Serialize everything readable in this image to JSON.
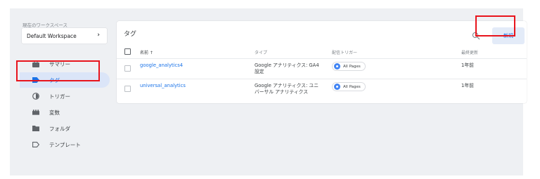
{
  "workspace": {
    "label": "現在のワークスペース",
    "name": "Default Workspace",
    "chevron": "›"
  },
  "sidebar": {
    "items": [
      {
        "label": "サマリー",
        "icon": "briefcase-icon"
      },
      {
        "label": "タグ",
        "icon": "tag-icon",
        "active": true
      },
      {
        "label": "トリガー",
        "icon": "trigger-icon"
      },
      {
        "label": "変数",
        "icon": "variables-icon"
      },
      {
        "label": "フォルダ",
        "icon": "folder-icon"
      },
      {
        "label": "テンプレート",
        "icon": "template-icon"
      }
    ]
  },
  "main": {
    "title": "タグ",
    "new_button": "新規",
    "columns": {
      "name": "名前 ↑",
      "type": "タイプ",
      "trigger": "配信トリガー",
      "updated": "最終更新"
    },
    "rows": [
      {
        "name": "google_analytics4",
        "type_line1": "Google アナリティクス: GA4",
        "type_line2": "設定",
        "trigger": "All Pages",
        "updated": "1年前"
      },
      {
        "name": "universal_analytics",
        "type_line1": "Google アナリティクス: ユニ",
        "type_line2": "バーサル アナリティクス",
        "trigger": "All Pages",
        "updated": "1年前"
      }
    ]
  },
  "colors": {
    "accent": "#1a73e8",
    "highlight": "#e8141c",
    "active_bg": "#dbe5f8"
  }
}
